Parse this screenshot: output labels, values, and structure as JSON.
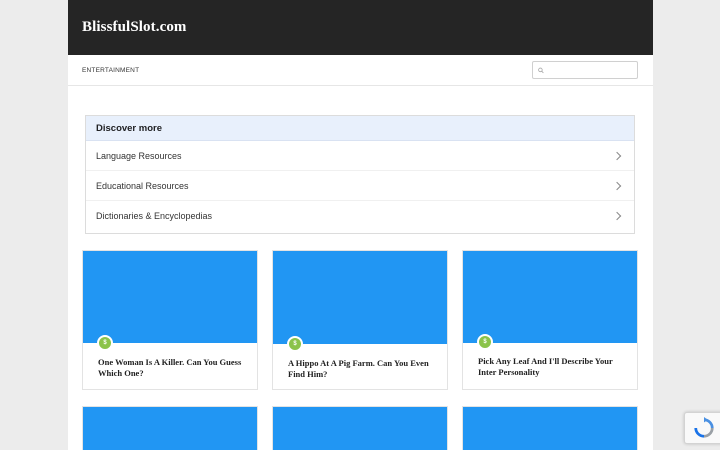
{
  "site": {
    "title": "BlissfulSlot.com"
  },
  "nav": {
    "category": "ENTERTAINMENT",
    "search_placeholder": ""
  },
  "discover": {
    "heading": "Discover more",
    "items": [
      {
        "label": "Language Resources"
      },
      {
        "label": "Educational Resources"
      },
      {
        "label": "Dictionaries & Encyclopedias"
      }
    ]
  },
  "cards": [
    {
      "title": "One Woman Is A Killer. Can You Guess Which One?",
      "badge": "$"
    },
    {
      "title": "A Hippo At A Pig Farm. Can You Even Find Him?",
      "badge": "$"
    },
    {
      "title": "Pick Any Leaf And I'll Describe Your Inter Personality",
      "badge": "$"
    },
    {
      "title": "",
      "badge": ""
    },
    {
      "title": "",
      "badge": ""
    },
    {
      "title": "",
      "badge": ""
    }
  ],
  "colors": {
    "header": "#252525",
    "card_image": "#2196f3",
    "badge": "#8bc34a",
    "discover_head": "#e8f0fc"
  },
  "icons": {
    "search": "search-icon",
    "chevron": "chevron-right-icon",
    "recaptcha": "recaptcha-icon"
  }
}
